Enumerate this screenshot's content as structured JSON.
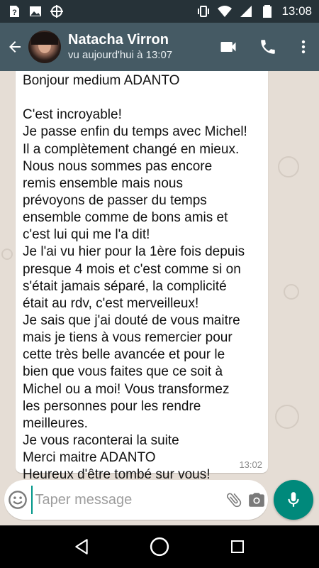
{
  "status_bar": {
    "time": "13:08",
    "left_icons": [
      "question-icon",
      "image-icon",
      "crosshair-icon"
    ],
    "right_icons": [
      "vibrate-icon",
      "wifi-icon",
      "signal-icon",
      "battery-icon"
    ]
  },
  "header": {
    "contact_name": "Natacha Virron",
    "last_seen": "vu aujourd'hui à 13:07",
    "color": "#455A64"
  },
  "message": {
    "lines": [
      "Bonjour medium ADANTO",
      "",
      "C'est incroyable!",
      "Je passe enfin du temps avec Michel!",
      "Il a complètement changé en mieux.",
      "Nous nous sommes pas encore",
      "remis ensemble mais nous",
      "prévoyons de passer du temps",
      "ensemble comme de bons amis et",
      "c'est lui qui me l'a dit!",
      "Je l'ai vu hier pour la 1ère fois depuis",
      "presque 4 mois et c'est comme si on",
      "s'était jamais séparé, la complicité",
      "était au rdv, c'est merveilleux!",
      "Je sais que j'ai douté de vous maitre",
      "mais je tiens à vous remercier pour",
      "cette très belle avancée et pour le",
      "bien que vous faites que ce soit à",
      "Michel ou a moi! Vous transformez",
      "les personnes pour les rendre",
      "meilleures.",
      "Je vous raconterai la suite",
      "Merci maitre ADANTO",
      "Heureux d'être tombé sur vous!"
    ],
    "time": "13:02"
  },
  "composer": {
    "placeholder": "Taper message",
    "value": "",
    "accent": "#00897B"
  },
  "nav": {
    "icons": [
      "back-triangle-icon",
      "home-circle-icon",
      "recents-square-icon"
    ]
  }
}
